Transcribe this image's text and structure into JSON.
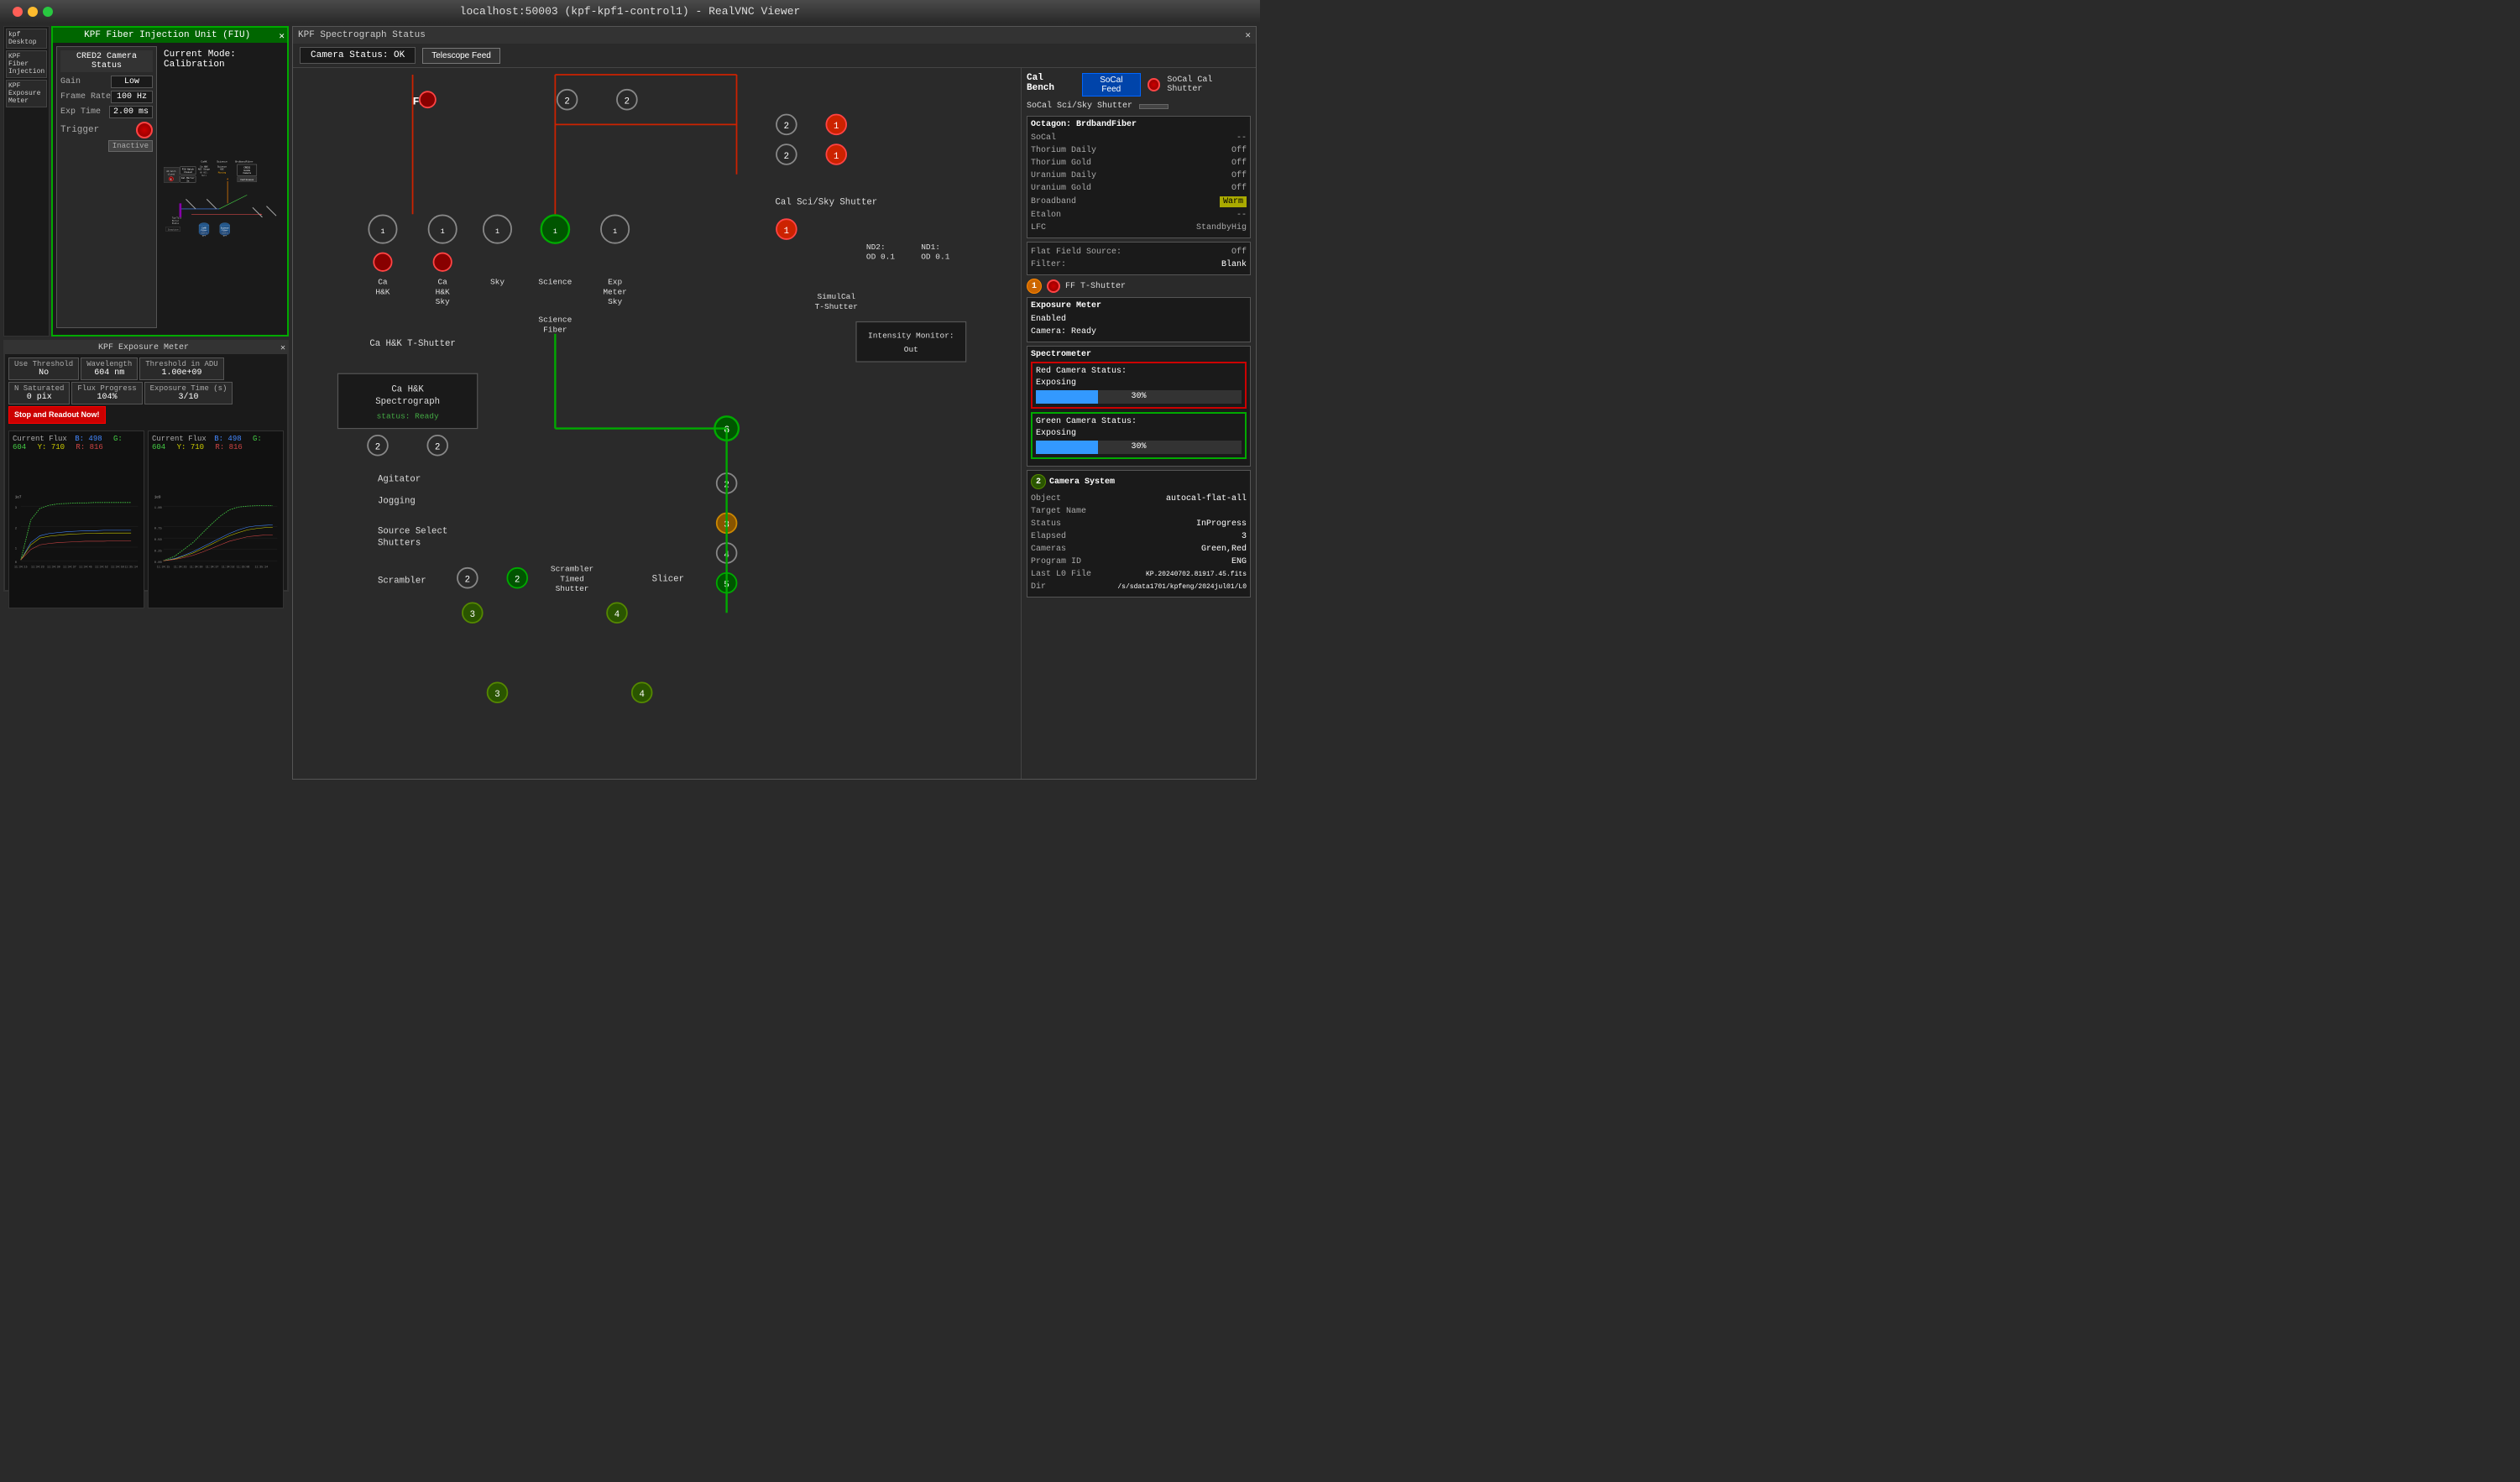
{
  "window": {
    "title": "localhost:50003 (kpf-kpf1-control1) - RealVNC Viewer",
    "traffic_lights": [
      "red",
      "yellow",
      "green"
    ]
  },
  "fiu_window": {
    "title": "KPF Fiber Injection Unit (FIU)",
    "mode_label": "Current Mode: Calibration",
    "cred2": {
      "title": "CRED2 Camera Status",
      "gain_label": "Gain",
      "gain_value": "Low",
      "frame_rate_label": "Frame Rate",
      "frame_rate_value": "100  Hz",
      "exp_time_label": "Exp Time",
      "exp_time_value": "2.00  ms",
      "trigger_label": "Trigger",
      "trigger_value": "Inactive"
    },
    "fiu_hatch_label": "FIU Hatch",
    "fiu_hatch_state": "Closed",
    "cal_mirror_label": "Cal Mirror",
    "cal_mirror_state": "In",
    "ao_hatch_label": "AO hatch closed",
    "tip_tilt_label": "Tip/Tilt Mirror Status",
    "tip_tilt_state": "Inactive",
    "cahk_adc_label": "Ca H&K ADC Stage",
    "cahk_hkadc_label": "HK ADC:",
    "cahk_hkadc_val": "Null",
    "science_adc_label": "Science ADC",
    "science_adc_state": "Moving",
    "broadband_fiber_label": "BrdbandFiber",
    "cred2_guide_camera_label": "CRED2 Guide Camera",
    "continuous_label": "Continuous",
    "cahk_fiber_camera_label": "CaHK Fiber Camera",
    "cahk_fiber_camera_state": "Off",
    "science_fiber_camera_label": "Science Fiber Camera",
    "science_fiber_camera_state": "Off",
    "cahk_label": "CaHK",
    "science_label": "Science"
  },
  "exposure_meter": {
    "title": "KPF Exposure Meter",
    "use_threshold_label": "Use Threshold",
    "use_threshold_value": "No",
    "wavelength_label": "Wavelength",
    "wavelength_value": "604 nm",
    "threshold_label": "Threshold in ADU",
    "threshold_value": "1.00e+09",
    "n_saturated_label": "N Saturated",
    "n_saturated_value": "0 pix",
    "flux_progress_label": "Flux Progress",
    "flux_progress_value": "104%",
    "exp_time_label": "Exposure Time (s)",
    "exp_time_value": "3/10",
    "stop_readout_label": "Stop and Readout Now!",
    "chart1_title": "Current Flux",
    "chart1_b": "498",
    "chart1_g": "604",
    "chart1_y": "710",
    "chart1_r": "816",
    "chart1_scale": "1e7",
    "chart2_title": "Current Flux",
    "chart2_b": "498",
    "chart2_g": "604",
    "chart2_y": "710",
    "chart2_r": "816",
    "chart2_scale": "1e9",
    "time_labels": [
      "11:34:15",
      "11:34:23",
      "11:34:30",
      "11:34:37",
      "11:34:45",
      "11:34:52",
      "11:34:59",
      "11:35:06",
      "11:35:13",
      "11:35:14"
    ]
  },
  "spectrograph": {
    "title": "KPF Spectrograph Status",
    "camera_status": "Camera Status: OK",
    "telescope_feed_label": "Telescope Feed",
    "cal_bench_label": "Cal Bench",
    "socal_feed_label": "SoCal Feed",
    "socal_cal_shutter_label": "SoCal Cal Shutter",
    "socal_sci_sky_shutter_label": "SoCal Sci/Sky Shutter",
    "fiu_label": "FIU",
    "cal_sci_sky_shutter_label": "Cal Sci/Sky Shutter",
    "nd2_label": "ND2:",
    "nd2_val": "OD 0.1",
    "nd1_label": "ND1:",
    "nd1_val": "OD 0.1",
    "simulcal_label": "SimulCal T-Shutter",
    "intensity_monitor_label": "Intensity Monitor:",
    "intensity_monitor_val": "Out",
    "octagon_label": "Octagon: BrdbandFiber",
    "octagon_items": [
      {
        "label": "SoCal",
        "value": "--"
      },
      {
        "label": "Thorium Daily",
        "value": "Off"
      },
      {
        "label": "Thorium Gold",
        "value": "Off"
      },
      {
        "label": "Uranium Daily",
        "value": "Off"
      },
      {
        "label": "Uranium Gold",
        "value": "Off"
      },
      {
        "label": "Broadband",
        "value": "Warm"
      },
      {
        "label": "Etalon",
        "value": "--"
      },
      {
        "label": "LFC",
        "value": "StandbyHig"
      }
    ],
    "flat_field_label": "Flat Field Source:",
    "flat_field_val": "Off",
    "filter_label": "Filter:",
    "filter_val": "Blank",
    "ff_tshutter_label": "FF T-Shutter",
    "ca_hk_shutter_label": "Ca H&K T-Shutter",
    "ca_hk_spectrograph_label": "Ca H&K Spectrograph",
    "ca_hk_status": "status: Ready",
    "agitator_label": "Agitator",
    "jogging_label": "Jogging",
    "source_select_label": "Source Select Shutters",
    "scrambler_label": "Scrambler",
    "scrambler_timed_label": "Scrambler Timed Shutter",
    "slicer_label": "Slicer",
    "exposure_meter_label": "Exposure Meter",
    "exp_meter_enabled": "Enabled",
    "exp_meter_camera": "Camera:  Ready",
    "spectrometer_label": "Spectrometer",
    "red_camera_label": "Red Camera Status:",
    "red_camera_state": "Exposing",
    "red_progress": "30%",
    "green_camera_label": "Green Camera Status:",
    "green_camera_state": "Exposing",
    "green_progress": "30%",
    "camera_system_label": "Camera System",
    "object_label": "Object",
    "object_val": "autocal-flat-all",
    "target_name_label": "Target Name",
    "target_name_val": "",
    "status_label": "Status",
    "status_val": "InProgress",
    "elapsed_label": "Elapsed",
    "elapsed_val": "3",
    "cameras_label": "Cameras",
    "cameras_val": "Green,Red",
    "program_id_label": "Program ID",
    "program_id_val": "ENG",
    "last_l0_label": "Last L0 File",
    "last_l0_val": "KP.20240702.81917.45.fits",
    "dir_label": "Dir",
    "dir_val": "/s/sdata1701/kpfeng/2024jul01/L0",
    "fibers": {
      "ca_hk": "Ca H&K",
      "ca_hk_sky": "Ca H&K Sky",
      "sky": "Sky",
      "science": "Science",
      "exp_meter_sky": "Exp Meter Sky"
    },
    "science_fiber_label": "Science Fiber"
  }
}
